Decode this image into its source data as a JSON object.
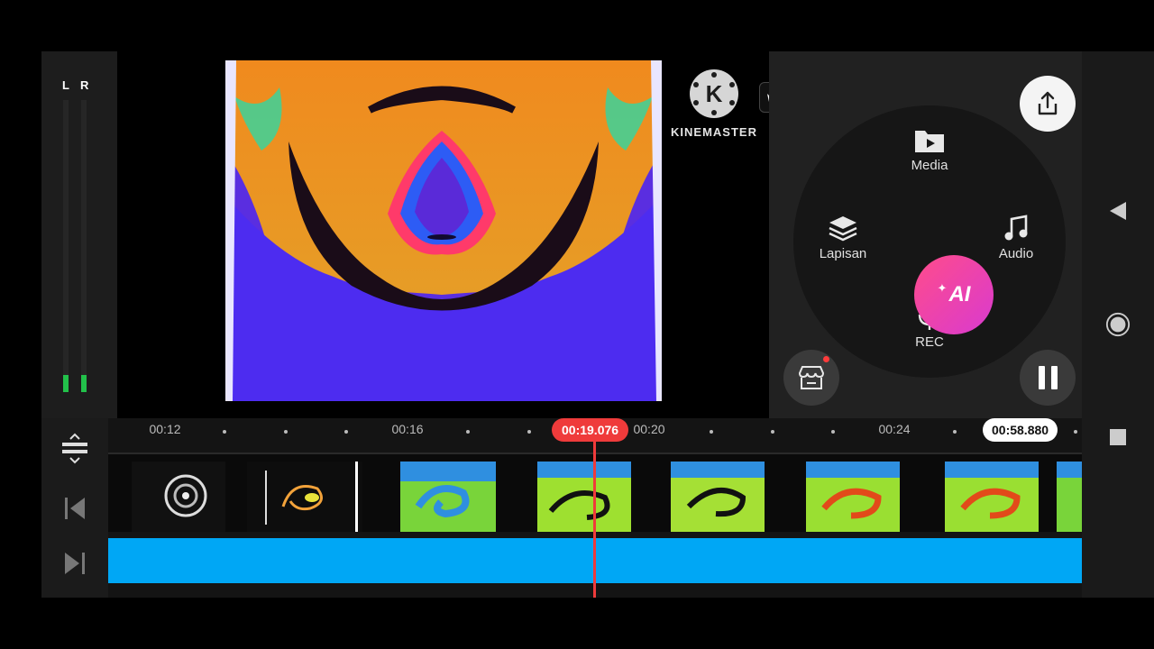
{
  "meter": {
    "left_label": "L",
    "right_label": "R",
    "left_level": 0.06,
    "right_level": 0.06
  },
  "brand": {
    "logo_letter": "K",
    "name": "KINEMASTER"
  },
  "menu": {
    "media_label": "Media",
    "layer_label": "Lapisan",
    "audio_label": "Audio",
    "rec_label": "REC",
    "ai_label": "AI"
  },
  "timeline": {
    "playhead_time": "00:19.076",
    "duration": "00:58.880",
    "ticks": [
      "00:12",
      "00:16",
      "00:20",
      "00:24"
    ]
  },
  "colors": {
    "accent": "#ef3b3b",
    "audio_track": "#00a7f5",
    "ai_gradient_start": "#ff4c8a",
    "ai_gradient_end": "#d93ad0",
    "level_green": "#22c14a"
  },
  "icons": {
    "export": "share-upload-icon",
    "store": "store-icon",
    "pause": "pause-icon",
    "premium": "crown-icon",
    "media": "media-folder-icon",
    "layer": "layers-icon",
    "audio": "music-note-icon",
    "rec": "microphone-icon",
    "nav_back": "triangle-back-icon",
    "nav_home": "circle-home-icon",
    "nav_recent": "square-recents-icon"
  }
}
